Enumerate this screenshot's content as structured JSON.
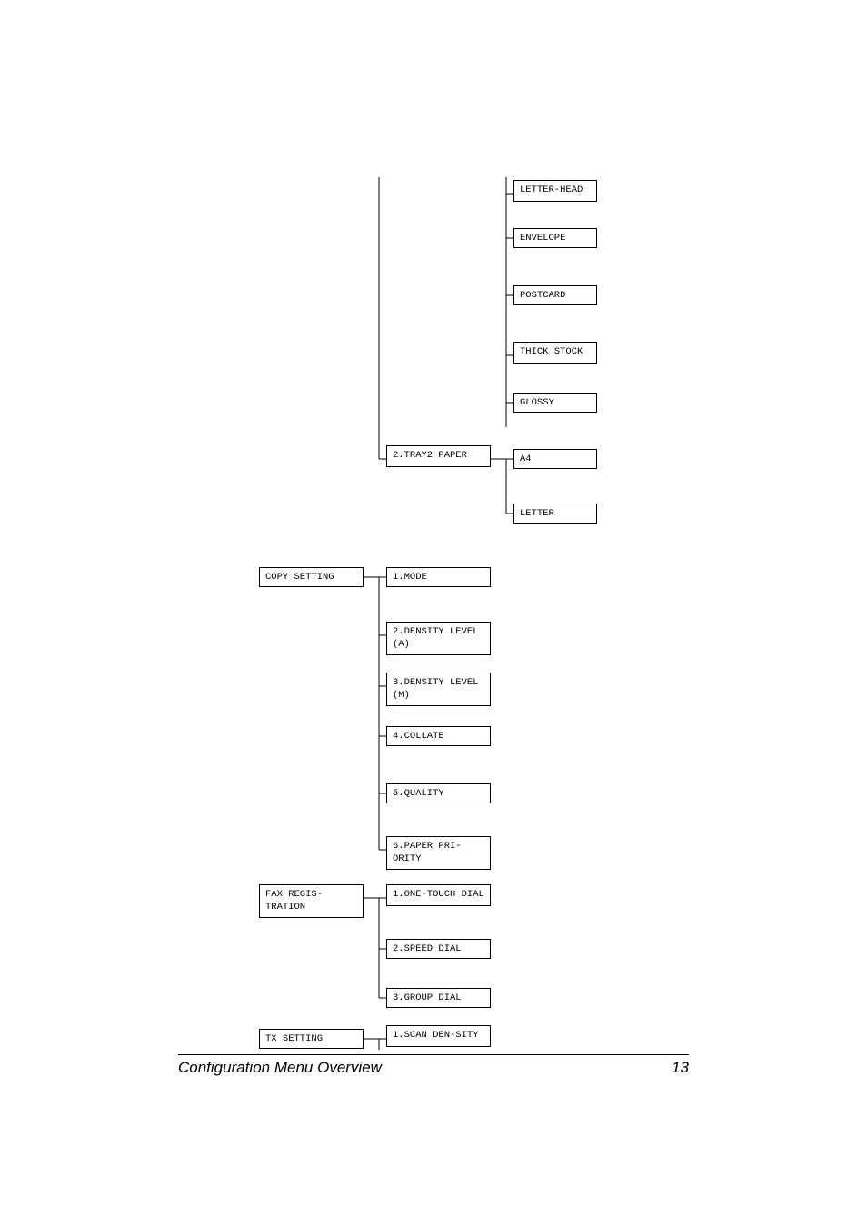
{
  "col3": {
    "item0": "LETTER-HEAD",
    "item1": "ENVELOPE",
    "item2": "POSTCARD",
    "item3": "THICK STOCK",
    "item4": "GLOSSY",
    "item5": "A4",
    "item6": "LETTER"
  },
  "col2": {
    "tray2": "2.TRAY2 PAPER",
    "mode": "1.MODE",
    "densityA": "2.DENSITY LEVEL (A)",
    "densityM": "3.DENSITY LEVEL (M)",
    "collate": "4.COLLATE",
    "quality": "5.QUALITY",
    "paperpri": "6.PAPER PRI-ORITY",
    "onetouch": "1.ONE-TOUCH DIAL",
    "speed": "2.SPEED DIAL",
    "group": "3.GROUP DIAL",
    "scanden": "1.SCAN DEN-SITY"
  },
  "col1": {
    "copy": "COPY SETTING",
    "faxreg": "FAX REGIS-TRATION",
    "txset": "TX SETTING"
  },
  "footer": {
    "title": "Configuration Menu Overview",
    "page": "13"
  }
}
